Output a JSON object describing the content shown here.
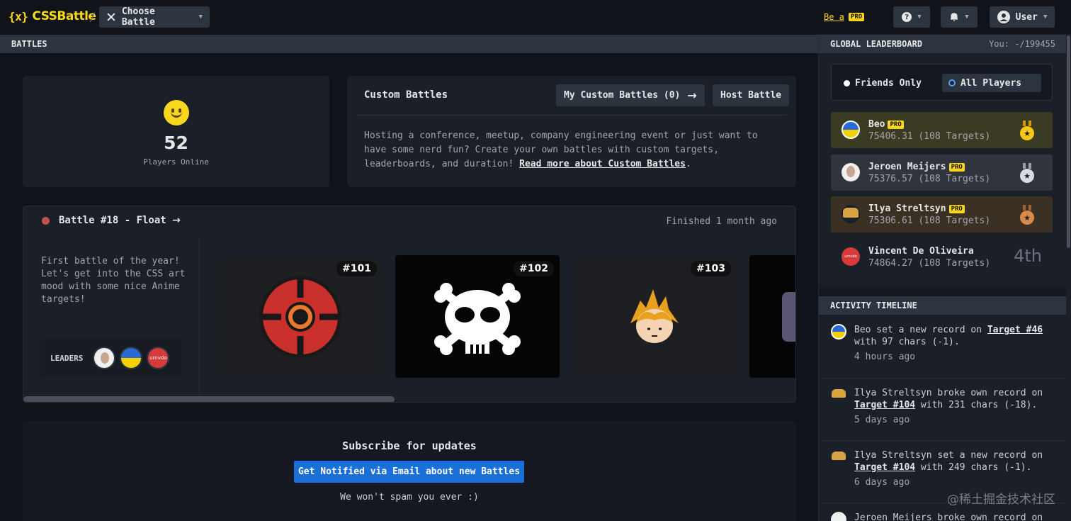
{
  "header": {
    "logo": "CSSBattle",
    "logo_mark": "{x}",
    "separator": "/",
    "choose_battle": "Choose Battle",
    "be_a": "Be a",
    "pro": "PRO",
    "help_icon": "?",
    "user": "User"
  },
  "battles_section": {
    "title": "BATTLES",
    "online_count": "52",
    "online_label": "Players Online",
    "custom": {
      "title": "Custom Battles",
      "my_custom": "My Custom Battles (0)",
      "host": "Host Battle",
      "desc": "Hosting a conference, meetup, company engineering event or just want to have some nerd fun? Create your own battles with custom targets, leaderboards, and duration!",
      "read_more": "Read more about Custom Battles",
      "period": "."
    },
    "battle": {
      "title": "Battle #18 - Float",
      "status": "Finished 1 month ago",
      "desc": "First battle of the year! Let's get into the CSS art mood with some nice Anime targets!",
      "leaders_label": "LEADERS",
      "targets": [
        "#101",
        "#102",
        "#103"
      ],
      "scroll_progress": 0.48
    },
    "subscribe": {
      "title": "Subscribe for updates",
      "button": "Get Notified via Email about new Battles",
      "note": "We won't spam you ever :)"
    }
  },
  "leaderboard": {
    "title": "GLOBAL LEADERBOARD",
    "you": "You: -/199455",
    "friends_only": "Friends Only",
    "all_players": "All Players",
    "players": [
      {
        "name": "Beo",
        "pro": true,
        "score": "75406.31 (108 Targets)",
        "medal": "gold"
      },
      {
        "name": "Jeroen Meijers",
        "pro": true,
        "score": "75376.57 (108 Targets)",
        "medal": "silver"
      },
      {
        "name": "Ilya Streltsyn",
        "pro": true,
        "score": "75306.61 (108 Targets)",
        "medal": "bronze"
      },
      {
        "name": "Vincent De Oliveira",
        "pro": false,
        "score": "74864.27 (108 Targets)",
        "rank": "4th"
      }
    ]
  },
  "activity": {
    "title": "ACTIVITY TIMELINE",
    "items": [
      {
        "pre": "Beo set a new record on ",
        "link": "Target #46",
        "post": " with 97 chars (-1).",
        "time": "4 hours ago"
      },
      {
        "pre": "Ilya Streltsyn broke own record on ",
        "link": "Target #104",
        "post": " with 231 chars (-18).",
        "time": "5 days ago"
      },
      {
        "pre": "Ilya Streltsyn set a new record on ",
        "link": "Target #104",
        "post": " with 249 chars (-1).",
        "time": "6 days ago"
      },
      {
        "pre": "Jeroen Meijers broke own record on",
        "link": "",
        "post": "",
        "time": ""
      }
    ]
  },
  "watermark": "@稀土掘金技术社区",
  "colors": {
    "brand": "#f9d71c",
    "accent": "#1a6fd8",
    "bg": "#11131a",
    "card": "#1b1f27"
  }
}
